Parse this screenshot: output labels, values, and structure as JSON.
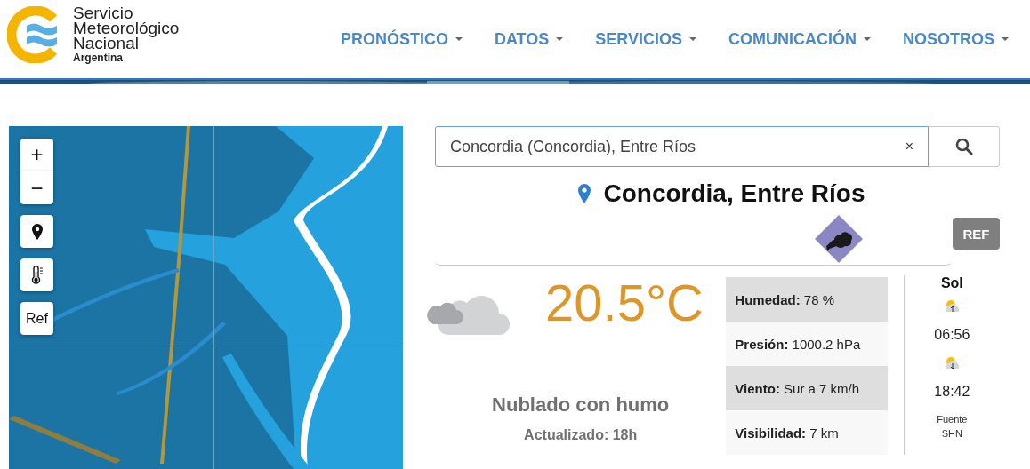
{
  "logo": {
    "lines": [
      "Servicio",
      "Meteorológico",
      "Nacional"
    ],
    "subtitle": "Argentina"
  },
  "nav": [
    {
      "label": "PRONÓSTICO"
    },
    {
      "label": "DATOS"
    },
    {
      "label": "SERVICIOS"
    },
    {
      "label": "COMUNICACIÓN"
    },
    {
      "label": "NOSOTROS"
    }
  ],
  "map": {
    "controls": [
      {
        "kind": "zoom",
        "labels": [
          "+",
          "−"
        ]
      },
      {
        "kind": "pin"
      },
      {
        "kind": "thermometer"
      },
      {
        "kind": "text",
        "label": "Ref"
      }
    ]
  },
  "search": {
    "value": "Concordia (Concordia), Entre Ríos",
    "clear": "×"
  },
  "location": "Concordia, Entre Ríos",
  "ref_button": "REF",
  "current": {
    "temperature": "20.5°C",
    "description": "Nublado con humo",
    "updated": "Actualizado: 18h"
  },
  "stats": [
    {
      "text": "**Humedad:** 78 %"
    },
    {
      "text": "**Presión:** 1000.2 hPa"
    },
    {
      "text": "**Viento:** Sur a 7 km/h"
    },
    {
      "text": "**Visibilidad:** 7 km"
    }
  ],
  "sun": {
    "title": "Sol",
    "sunrise": "06:56",
    "sunset": "18:42",
    "source": "Fuente SHN"
  }
}
